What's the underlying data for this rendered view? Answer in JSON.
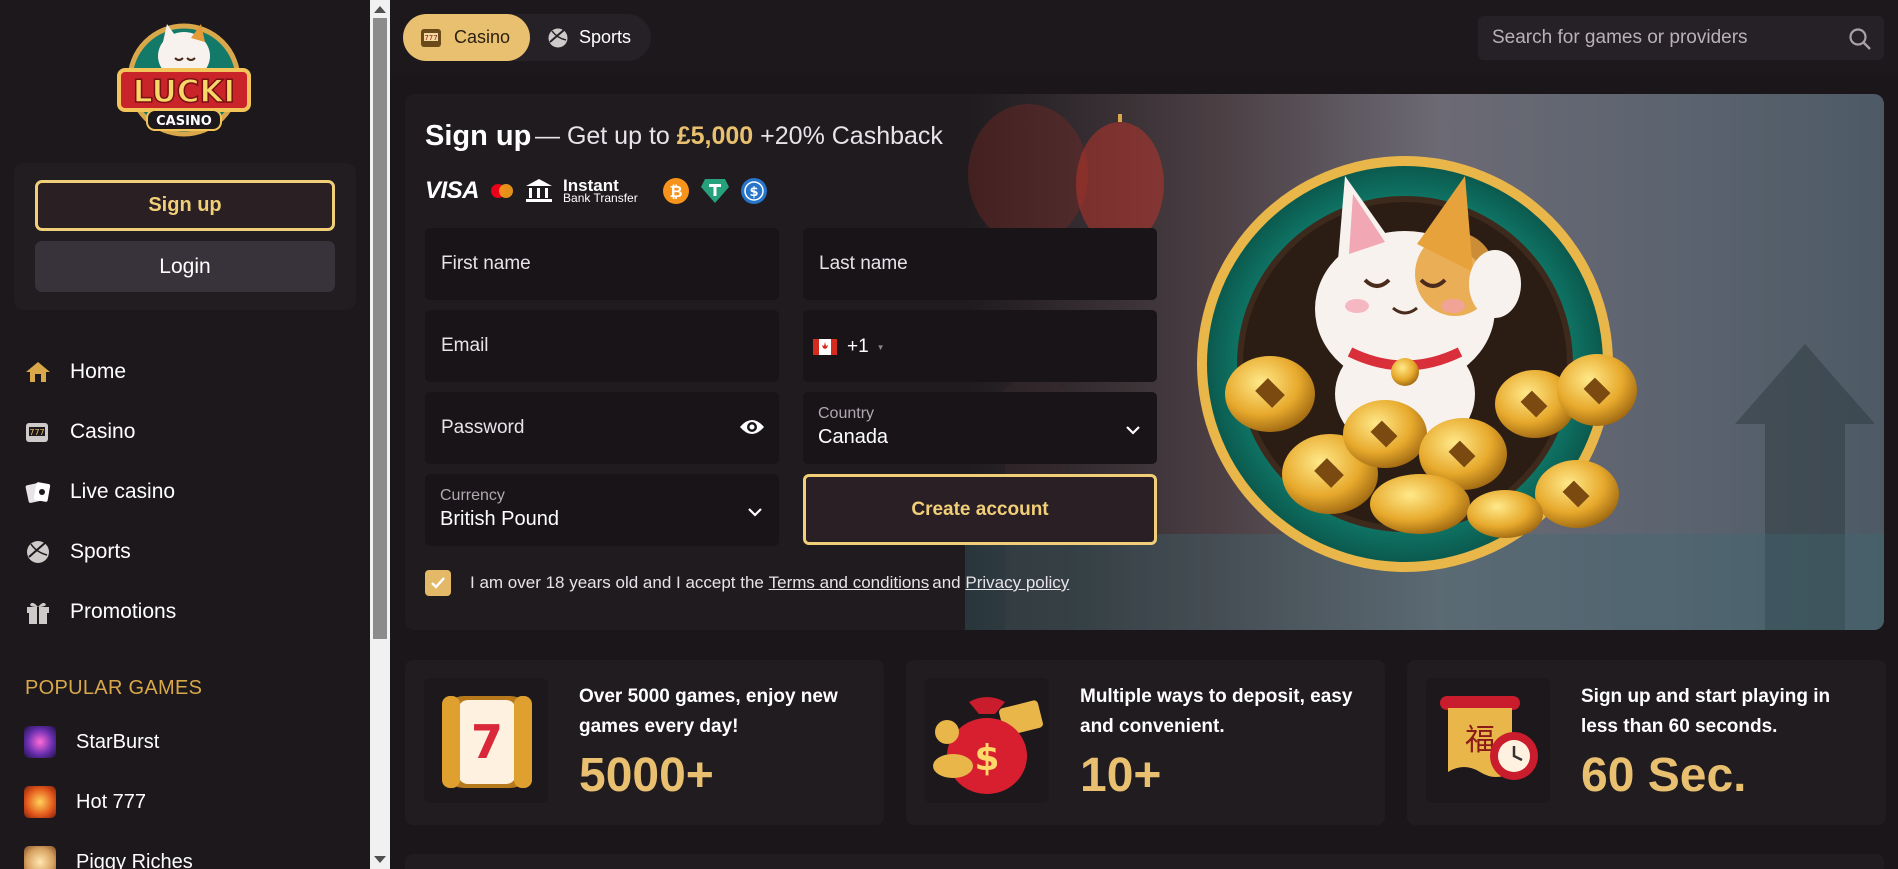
{
  "brand": {
    "logo_line1": "LUCKI",
    "logo_line2": "CASINO"
  },
  "sidebar": {
    "signup_label": "Sign up",
    "login_label": "Login",
    "nav": [
      {
        "label": "Home",
        "icon": "home-icon"
      },
      {
        "label": "Casino",
        "icon": "slot-machine-icon"
      },
      {
        "label": "Live casino",
        "icon": "cards-icon"
      },
      {
        "label": "Sports",
        "icon": "ball-icon"
      },
      {
        "label": "Promotions",
        "icon": "gift-icon"
      }
    ],
    "popular_title": "POPULAR GAMES",
    "games": [
      {
        "label": "StarBurst"
      },
      {
        "label": "Hot 777"
      },
      {
        "label": "Piggy Riches"
      }
    ]
  },
  "topbar": {
    "tab_casino": "Casino",
    "tab_sports": "Sports",
    "search_placeholder": "Search for games or providers"
  },
  "hero": {
    "title": "Sign up",
    "sub_prefix": "— Get up to ",
    "sub_amount": "£5,000",
    "sub_suffix": " +20% Cashback",
    "payments": {
      "visa": "VISA",
      "bank_line1": "Instant",
      "bank_line2": "Bank Transfer"
    },
    "form": {
      "first_name": "First name",
      "last_name": "Last name",
      "email": "Email",
      "phone_code": "+1",
      "password": "Password",
      "country_label": "Country",
      "country_value": "Canada",
      "currency_label": "Currency",
      "currency_value": "British Pound",
      "create_label": "Create account"
    },
    "terms": {
      "prefix": "I am over 18 years old and I accept the ",
      "link1": "Terms and conditions ",
      "middle": "and ",
      "link2": "Privacy policy"
    }
  },
  "features": [
    {
      "text": "Over 5000 games, enjoy new games every day!",
      "number": "5000+"
    },
    {
      "text": "Multiple ways to deposit, easy and convenient.",
      "number": "10+"
    },
    {
      "text": "Sign up and start playing in less than 60 seconds.",
      "number": "60 Sec."
    }
  ],
  "colors": {
    "accent": "#e8c070",
    "background": "#1a1619",
    "panel": "#211c20"
  }
}
